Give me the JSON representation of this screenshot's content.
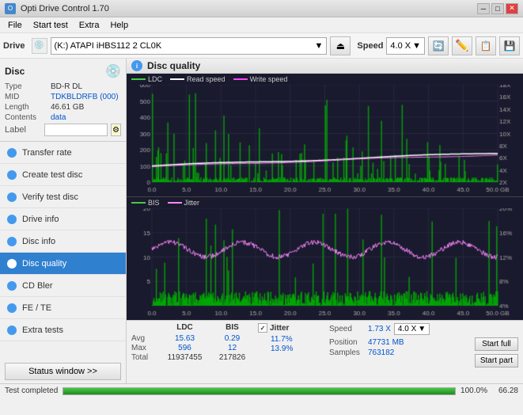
{
  "window": {
    "title": "Opti Drive Control 1.70",
    "icon": "O"
  },
  "titlebar": {
    "minimize": "─",
    "maximize": "□",
    "close": "✕"
  },
  "menu": {
    "items": [
      "File",
      "Start test",
      "Extra",
      "Help"
    ]
  },
  "toolbar": {
    "drive_label": "Drive",
    "drive_icon": "💿",
    "drive_value": "(K:)  ATAPI iHBS112  2 CL0K",
    "eject_icon": "⏏",
    "speed_label": "Speed",
    "speed_value": "4.0 X",
    "btn1": "🔄",
    "btn2": "🖊",
    "btn3": "📋",
    "btn4": "💾"
  },
  "disc": {
    "title": "Disc",
    "icon": "💿",
    "type_label": "Type",
    "type_value": "BD-R DL",
    "mid_label": "MID",
    "mid_value": "TDKBLDRFB (000)",
    "length_label": "Length",
    "length_value": "46.61 GB",
    "contents_label": "Contents",
    "contents_value": "data",
    "label_label": "Label",
    "label_value": "",
    "label_placeholder": ""
  },
  "nav": {
    "items": [
      {
        "id": "transfer-rate",
        "label": "Transfer rate",
        "active": false
      },
      {
        "id": "create-test-disc",
        "label": "Create test disc",
        "active": false
      },
      {
        "id": "verify-test-disc",
        "label": "Verify test disc",
        "active": false
      },
      {
        "id": "drive-info",
        "label": "Drive info",
        "active": false
      },
      {
        "id": "disc-info",
        "label": "Disc info",
        "active": false
      },
      {
        "id": "disc-quality",
        "label": "Disc quality",
        "active": true
      },
      {
        "id": "cd-bler",
        "label": "CD Bler",
        "active": false
      },
      {
        "id": "fe-te",
        "label": "FE / TE",
        "active": false
      },
      {
        "id": "extra-tests",
        "label": "Extra tests",
        "active": false
      }
    ]
  },
  "status_window_btn": "Status window >>",
  "progress": {
    "value": 100,
    "text": "100.0%",
    "status": "Test completed",
    "right_value": "66.28"
  },
  "disc_quality": {
    "title": "Disc quality",
    "legend": {
      "ldc_label": "LDC",
      "read_speed_label": "Read speed",
      "write_speed_label": "Write speed",
      "bis_label": "BIS",
      "jitter_label": "Jitter"
    }
  },
  "stats": {
    "col_ldc": "LDC",
    "col_bis": "BIS",
    "col_jitter": "Jitter",
    "row_avg": "Avg",
    "row_max": "Max",
    "row_total": "Total",
    "ldc_avg": "15.63",
    "ldc_max": "596",
    "ldc_total": "11937455",
    "bis_avg": "0.29",
    "bis_max": "12",
    "bis_total": "217826",
    "jitter_avg": "11.7%",
    "jitter_max": "13.9%",
    "jitter_checked": true,
    "speed_label": "Speed",
    "speed_value": "1.73 X",
    "speed_dropdown": "4.0 X",
    "position_label": "Position",
    "position_value": "47731 MB",
    "samples_label": "Samples",
    "samples_value": "763182",
    "start_full_label": "Start full",
    "start_part_label": "Start part"
  },
  "chart1": {
    "y_max": 600,
    "y_labels": [
      "600",
      "500",
      "400",
      "300",
      "200",
      "100",
      "0.0"
    ],
    "y_right_labels": [
      "18X",
      "16X",
      "14X",
      "12X",
      "10X",
      "8X",
      "6X",
      "4X",
      "2X"
    ],
    "x_labels": [
      "0.0",
      "5.0",
      "10.0",
      "15.0",
      "20.0",
      "25.0",
      "30.0",
      "35.0",
      "40.0",
      "45.0",
      "50.0 GB"
    ]
  },
  "chart2": {
    "y_max": 20,
    "y_labels": [
      "20",
      "15",
      "10",
      "5",
      "0.0"
    ],
    "y_right_labels": [
      "20%",
      "16%",
      "12%",
      "8%",
      "4%"
    ],
    "x_labels": [
      "0.0",
      "5.0",
      "10.0",
      "15.0",
      "20.0",
      "25.0",
      "30.0",
      "35.0",
      "40.0",
      "45.0",
      "50.0 GB"
    ]
  }
}
